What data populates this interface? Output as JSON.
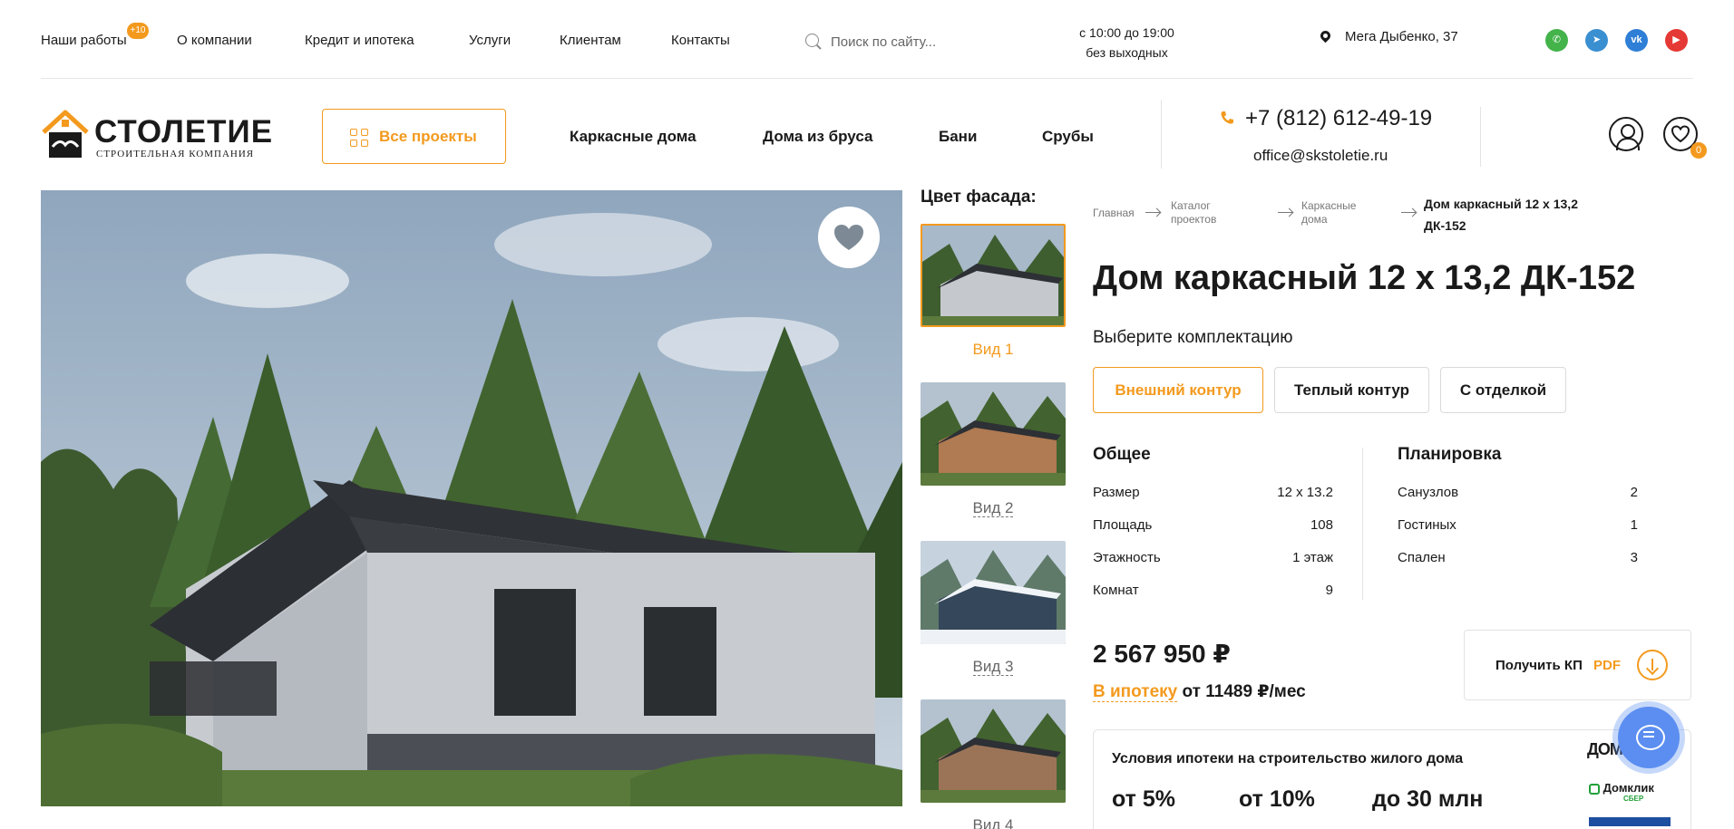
{
  "top_nav": {
    "items": [
      "Наши работы",
      "О компании",
      "Кредит и ипотека",
      "Услуги",
      "Клиентам",
      "Контакты"
    ],
    "works_badge": "+10"
  },
  "search": {
    "placeholder": "Поиск по сайту..."
  },
  "hours": {
    "line1": "с 10:00 до 19:00",
    "line2": "без выходных"
  },
  "address": "Мега Дыбенко, 37",
  "social": [
    "whatsapp-icon",
    "telegram-icon",
    "vk-icon",
    "youtube-icon"
  ],
  "logo": {
    "name": "СТОЛЕТИЕ",
    "tagline": "СТРОИТЕЛЬНАЯ КОМПАНИЯ"
  },
  "header": {
    "all_projects": "Все проекты",
    "nav": [
      "Каркасные дома",
      "Дома из бруса",
      "Бани",
      "Срубы"
    ],
    "phone": "+7 (812) 612-49-19",
    "email": "office@skstoletie.ru",
    "favorites_count": "0"
  },
  "facade": {
    "title": "Цвет фасада:",
    "views": [
      "Вид 1",
      "Вид 2",
      "Вид 3",
      "Вид 4"
    ],
    "selected": 0
  },
  "breadcrumbs": [
    "Главная",
    "Каталог проектов",
    "Каркасные дома",
    "Дом каркасный 12 х 13,2 ДК-152"
  ],
  "product": {
    "title": "Дом каркасный 12 х 13,2 ДК-152",
    "config_label": "Выберите комплектацию",
    "configs": [
      "Внешний контур",
      "Теплый контур",
      "С отделкой"
    ],
    "selected_config": 0,
    "general": {
      "heading": "Общее",
      "rows": [
        {
          "label": "Размер",
          "value": "12 х 13.2"
        },
        {
          "label": "Площадь",
          "value": "108"
        },
        {
          "label": "Этажность",
          "value": "1 этаж"
        },
        {
          "label": "Комнат",
          "value": "9"
        }
      ]
    },
    "layout": {
      "heading": "Планировка",
      "rows": [
        {
          "label": "Санузлов",
          "value": "2"
        },
        {
          "label": "Гостиных",
          "value": "1"
        },
        {
          "label": "Спален",
          "value": "3"
        }
      ]
    },
    "price": "2 567 950 ₽",
    "mortgage_link": "В ипотеку",
    "mortgage_rest": "от 11489 ₽/мес",
    "kp": {
      "label": "Получить КП",
      "format": "PDF"
    }
  },
  "mortgage_box": {
    "heading": "Условия ипотеки на строительство жилого дома",
    "values": [
      "от 5%",
      "от 10%",
      "до 30 млн"
    ],
    "banks": [
      "ДОМ.РФ",
      "Домклик",
      "СБЕР"
    ]
  },
  "colors": {
    "accent": "#f39a1e",
    "text": "#1a1a1a",
    "chat": "#5b8ef0"
  }
}
